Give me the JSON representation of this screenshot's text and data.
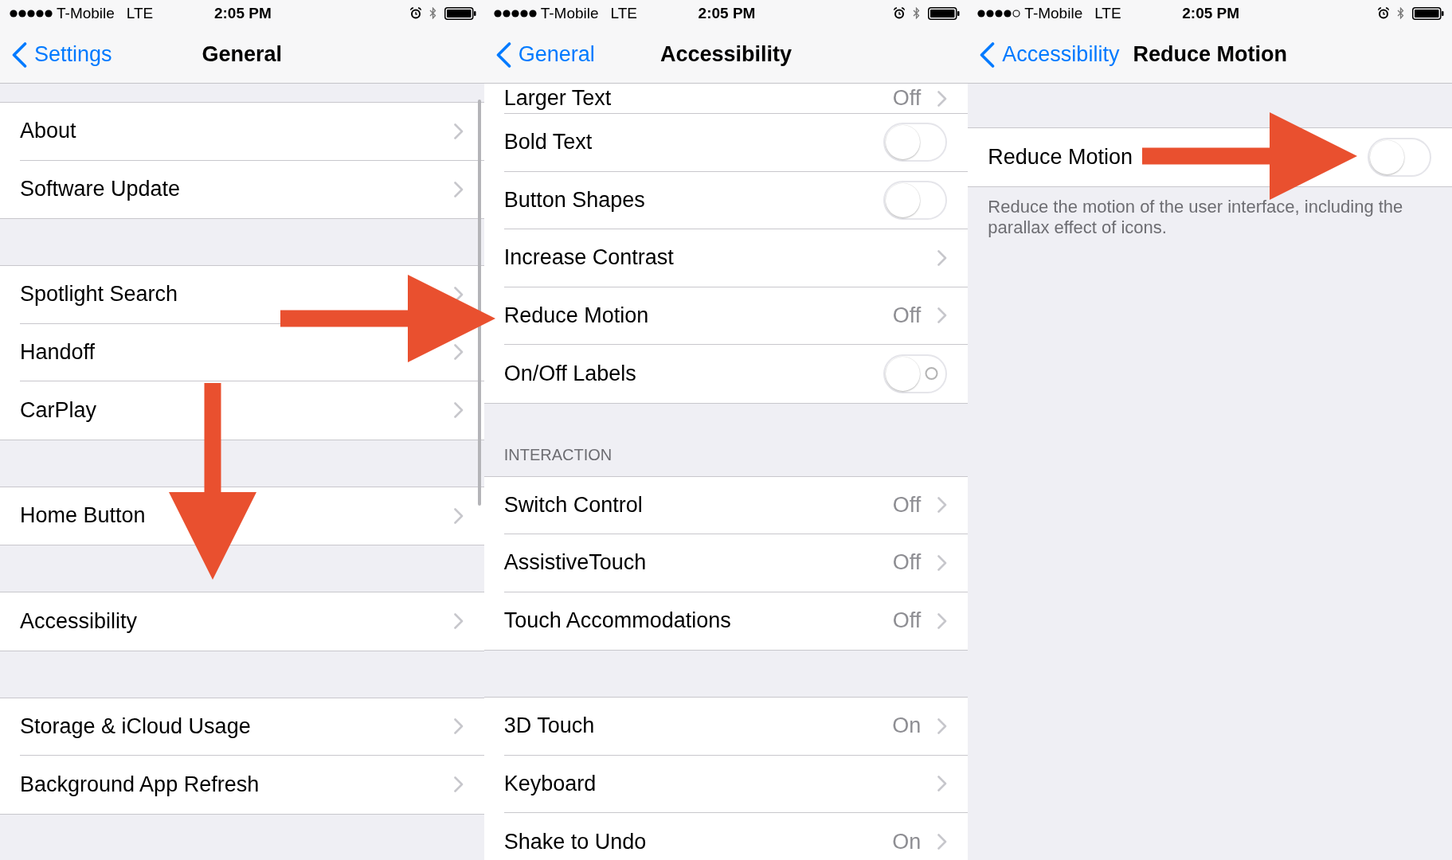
{
  "panels": [
    {
      "scrolled": true,
      "first_row_cut": false,
      "status_bar": {
        "carrier": "T-Mobile",
        "network": "LTE",
        "time": "2:05 PM"
      },
      "nav": {
        "back": "Settings",
        "title": "General"
      },
      "sections": [
        {
          "rows": [
            {
              "kind": "link",
              "label": "About"
            },
            {
              "kind": "link",
              "label": "Software Update"
            }
          ]
        },
        {
          "rows": [
            {
              "kind": "link",
              "label": "Spotlight Search"
            },
            {
              "kind": "link",
              "label": "Handoff"
            },
            {
              "kind": "link",
              "label": "CarPlay"
            }
          ]
        },
        {
          "rows": [
            {
              "kind": "link",
              "label": "Home Button"
            }
          ]
        },
        {
          "rows": [
            {
              "kind": "link",
              "label": "Accessibility"
            }
          ]
        },
        {
          "rows": [
            {
              "kind": "link",
              "label": "Storage & iCloud Usage"
            },
            {
              "kind": "link",
              "label": "Background App Refresh"
            }
          ]
        }
      ]
    },
    {
      "scrolled": true,
      "first_row_cut": true,
      "status_bar": {
        "carrier": "T-Mobile",
        "network": "LTE",
        "time": "2:05 PM"
      },
      "nav": {
        "back": "General",
        "title": "Accessibility"
      },
      "sections": [
        {
          "rows": [
            {
              "kind": "link",
              "label": "Larger Text",
              "value": "Off"
            },
            {
              "kind": "toggle",
              "label": "Bold Text",
              "on": false,
              "labels": false
            },
            {
              "kind": "toggle",
              "label": "Button Shapes",
              "on": false,
              "labels": false
            },
            {
              "kind": "link",
              "label": "Increase Contrast"
            },
            {
              "kind": "link",
              "label": "Reduce Motion",
              "value": "Off"
            },
            {
              "kind": "toggle",
              "label": "On/Off Labels",
              "on": false,
              "labels": true
            }
          ]
        },
        {
          "header": "INTERACTION",
          "rows": [
            {
              "kind": "link",
              "label": "Switch Control",
              "value": "Off"
            },
            {
              "kind": "link",
              "label": "AssistiveTouch",
              "value": "Off"
            },
            {
              "kind": "link",
              "label": "Touch Accommodations",
              "value": "Off"
            }
          ]
        },
        {
          "rows": [
            {
              "kind": "link",
              "label": "3D Touch",
              "value": "On"
            },
            {
              "kind": "link",
              "label": "Keyboard"
            },
            {
              "kind": "link",
              "label": "Shake to Undo",
              "value": "On"
            }
          ]
        }
      ]
    },
    {
      "scrolled": false,
      "first_row_cut": false,
      "status_bar": {
        "carrier": "T-Mobile",
        "network": "LTE",
        "time": "2:05 PM"
      },
      "nav": {
        "back": "Accessibility",
        "title": "Reduce Motion"
      },
      "sections": [
        {
          "rows": [
            {
              "kind": "toggle",
              "label": "Reduce Motion",
              "on": false,
              "labels": false
            }
          ],
          "footer": "Reduce the motion of the user interface, including the parallax effect of icons."
        }
      ]
    }
  ],
  "annotations": [
    {
      "kind": "right"
    },
    {
      "kind": "down"
    },
    {
      "kind": "right"
    }
  ]
}
